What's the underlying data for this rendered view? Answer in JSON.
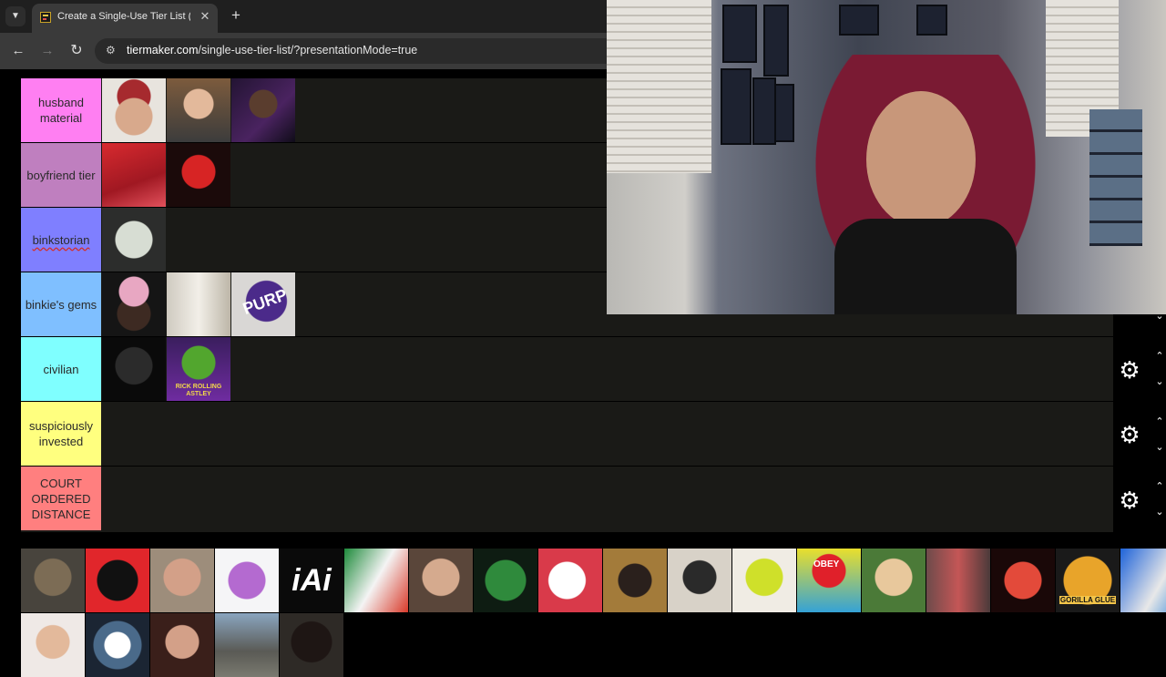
{
  "browser": {
    "tab_title": "Create a Single-Use Tier List (Pr",
    "url_host": "tiermaker.com",
    "url_rest": "/single-use-tier-list/?presentationMode=true"
  },
  "tiers": [
    {
      "label": "husband material",
      "color": "#ff7ff2"
    },
    {
      "label": "boyfriend tier",
      "color": "#bf7fbf"
    },
    {
      "label": "binkstorian",
      "color": "#7f7fff"
    },
    {
      "label": "binkie's gems",
      "color": "#7fbfff"
    },
    {
      "label": "civilian",
      "color": "#7fffff"
    },
    {
      "label": "suspiciously invested",
      "color": "#ffff7f"
    },
    {
      "label": "COURT ORDERED DISTANCE",
      "color": "#ff7f7f"
    }
  ],
  "thumb_texts": {
    "purp": "PURP",
    "pickle": "RICK ROLLING ASTLEY",
    "iai": "iAi",
    "obey": "OBEY",
    "gorilla": "GORILLA GLUE"
  }
}
